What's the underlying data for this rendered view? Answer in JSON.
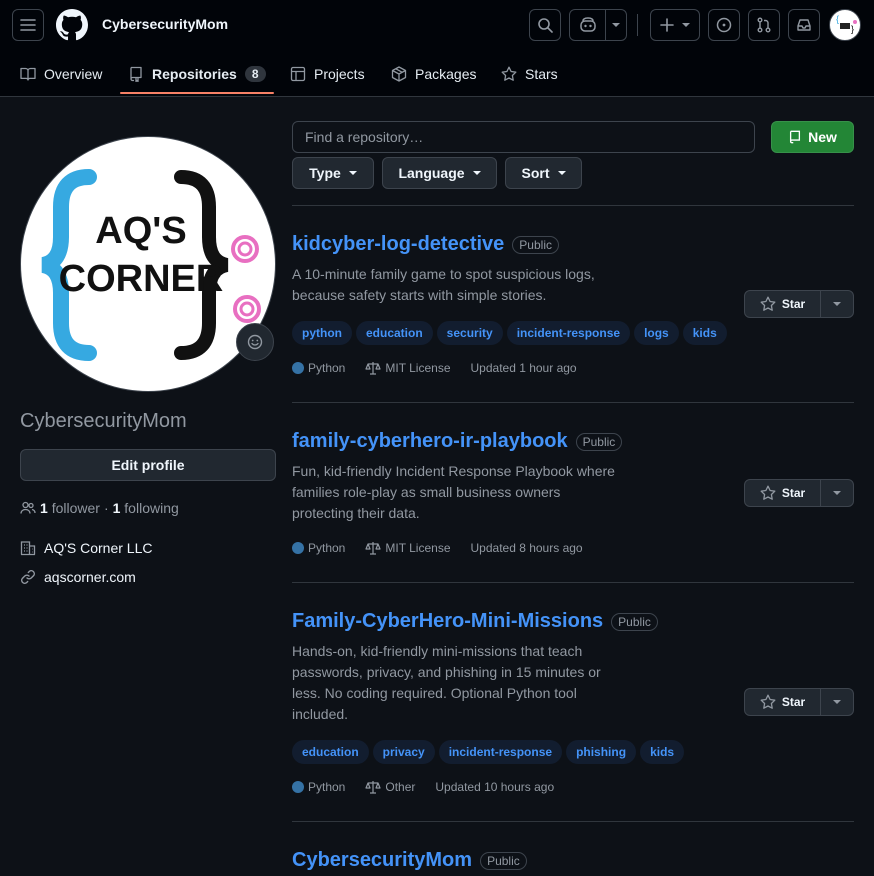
{
  "header": {
    "app_title": "CybersecurityMom",
    "avatar_label": "AQ'S CORNER"
  },
  "tabs": [
    {
      "label": "Overview"
    },
    {
      "label": "Repositories",
      "count": "8"
    },
    {
      "label": "Projects"
    },
    {
      "label": "Packages"
    },
    {
      "label": "Stars"
    }
  ],
  "profile": {
    "avatar_text_line1": "AQ'S",
    "avatar_text_line2": "CORNER",
    "username": "CybersecurityMom",
    "edit_label": "Edit profile",
    "followers_count": "1",
    "followers_word": "follower",
    "dot": "·",
    "following_count": "1",
    "following_word": "following",
    "company": "AQ'S Corner LLC",
    "website": "aqscorner.com"
  },
  "toolbar": {
    "search_placeholder": "Find a repository…",
    "new_label": "New",
    "type_label": "Type",
    "language_label": "Language",
    "sort_label": "Sort"
  },
  "repos": [
    {
      "name": "kidcyber-log-detective",
      "visibility": "Public",
      "description": "A 10-minute family game to spot suspicious logs, because safety starts with simple stories.",
      "topics": [
        "python",
        "education",
        "security",
        "incident-response",
        "logs",
        "kids"
      ],
      "language": "Python",
      "license": "MIT License",
      "updated": "Updated 1 hour ago",
      "star_label": "Star"
    },
    {
      "name": "family-cyberhero-ir-playbook",
      "visibility": "Public",
      "description": "Fun, kid-friendly Incident Response Playbook where families role-play as small business owners protecting their data.",
      "topics": [],
      "language": "Python",
      "license": "MIT License",
      "updated": "Updated 8 hours ago",
      "star_label": "Star"
    },
    {
      "name": "Family-CyberHero-Mini-Missions",
      "visibility": "Public",
      "description": "Hands-on, kid-friendly mini-missions that teach passwords, privacy, and phishing in 15 minutes or less. No coding required. Optional Python tool included.",
      "topics": [
        "education",
        "privacy",
        "incident-response",
        "phishing",
        "kids"
      ],
      "language": "Python",
      "license": "Other",
      "updated": "Updated 10 hours ago",
      "star_label": "Star"
    },
    {
      "name": "CybersecurityMom",
      "visibility": "Public"
    }
  ],
  "colors": {
    "accent_link": "#4493f8",
    "primary_button": "#238636",
    "tab_underline": "#f78166",
    "python_dot": "#3572A5"
  }
}
